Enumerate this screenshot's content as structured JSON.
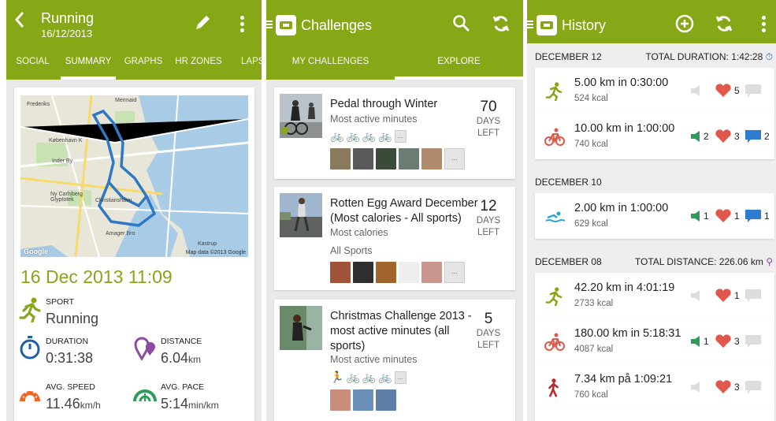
{
  "summary": {
    "title": "Running",
    "date": "16/12/2013",
    "tabs": [
      "SOCIAL",
      "SUMMARY",
      "GRAPHS",
      "HR ZONES",
      "LAPS"
    ],
    "active_tab": "SUMMARY",
    "map_attribution": "Map data ©2013 Google",
    "map_logo": "Google",
    "map_labels": [
      "Mermaid",
      "Frederiks",
      "København K",
      "Inder By",
      "Ny Carlsberg Glyptotek",
      "Christianshavn",
      "Amager Bro",
      "Kastrup"
    ],
    "datetime": "16 Dec 2013 11:09",
    "sport": {
      "label": "SPORT",
      "value": "Running",
      "icon": "running-icon"
    },
    "duration": {
      "label": "DURATION",
      "value": "0:31:38",
      "icon": "stopwatch-icon"
    },
    "distance": {
      "label": "DISTANCE",
      "value": "6.04",
      "unit": "km",
      "icon": "distance-pin-icon"
    },
    "avg_speed": {
      "label": "AVG. SPEED",
      "value": "11.46",
      "unit": "km/h",
      "icon": "speedometer-icon"
    },
    "avg_pace": {
      "label": "AVG. PACE",
      "value": "5:14",
      "unit": "min/km",
      "icon": "pace-gauge-icon"
    },
    "colors": {
      "brand": "#86a816",
      "accent_orange": "#f26522",
      "accent_blue": "#1f5fa8",
      "accent_purple": "#8d4aa3",
      "accent_green": "#2e9c5a"
    }
  },
  "challenges": {
    "title": "Challenges",
    "tabs": [
      "MY CHALLENGES",
      "EXPLORE"
    ],
    "active_tab": "EXPLORE",
    "items": [
      {
        "title": "Pedal through Winter",
        "subtitle": "Most active minutes",
        "days": "70",
        "days_label": "DAYS",
        "left_label": "LEFT",
        "sports": [
          "🚲",
          "🚲",
          "🚲",
          "🚲"
        ],
        "more": "...",
        "avatars_more": "..."
      },
      {
        "title": "Rotten Egg Award December (Most calories - All sports)",
        "subtitle": "Most calories",
        "subtitle2": "All Sports",
        "days": "12",
        "days_label": "DAYS",
        "left_label": "LEFT",
        "avatars_more": "..."
      },
      {
        "title": "Christmas Challenge 2013 - most active minutes (all sports)",
        "subtitle": "Most active minutes",
        "days": "5",
        "days_label": "DAYS",
        "left_label": "LEFT",
        "sports": [
          "🏃",
          "🚲",
          "🚲",
          "🚲"
        ],
        "more": "..."
      }
    ]
  },
  "history": {
    "title": "History",
    "sections": [
      {
        "date": "DECEMBER 12",
        "total_label": "TOTAL DURATION:",
        "total_value": "1:42:28",
        "entries": [
          {
            "sport": "running",
            "main": "5.00 km in 0:30:00",
            "kcal": "524 kcal",
            "likes": "5",
            "comments": "",
            "peps": ""
          },
          {
            "sport": "cycling",
            "main": "10.00 km in 1:00:00",
            "kcal": "740 kcal",
            "peps": "2",
            "likes": "3",
            "comments": "2"
          }
        ]
      },
      {
        "date": "DECEMBER 10",
        "total_label": "",
        "total_value": "",
        "entries": [
          {
            "sport": "swimming",
            "main": "2.00 km in 1:00:00",
            "kcal": "629 kcal",
            "peps": "1",
            "likes": "1",
            "comments": "1"
          }
        ]
      },
      {
        "date": "DECEMBER 08",
        "total_label": "TOTAL DISTANCE:",
        "total_value": "226.06 km",
        "entries": [
          {
            "sport": "running",
            "main": "42.20 km in 4:01:19",
            "kcal": "2733 kcal",
            "likes": "1",
            "peps": "",
            "comments": ""
          },
          {
            "sport": "cycling",
            "main": "180.00 km in 5:18:31",
            "kcal": "4087 kcal",
            "peps": "1",
            "likes": "3",
            "comments": ""
          },
          {
            "sport": "walking",
            "main": "7.34 km på 1:09:21",
            "kcal": "760 kcal",
            "likes": "3",
            "peps": "",
            "comments": ""
          }
        ]
      }
    ]
  }
}
